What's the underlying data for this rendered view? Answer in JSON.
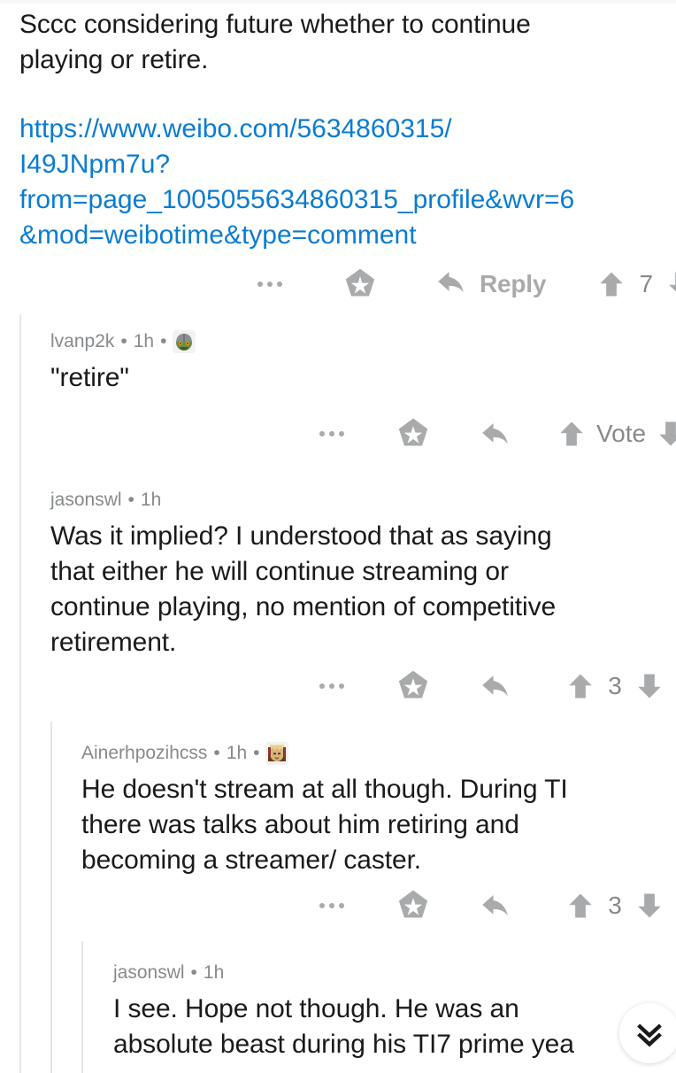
{
  "app": {
    "platform": "reddit-comment-thread",
    "link_color": "#0a7cd1",
    "meta_color": "#878a8c",
    "icon_color": "#a8aaab",
    "thread_line_color": "#e4e6e7",
    "background": "#ffffff"
  },
  "comments": [
    {
      "id": "root",
      "depth": 0,
      "body_lines": [
        "Sccc considering future whether to continue",
        "playing or retire."
      ],
      "link_lines": [
        "https://www.weibo.com/5634860315/",
        "I49JNpm7u?",
        "from=page_1005055634860315_profile&wvr=6",
        "&mod=weibotime&type=comment"
      ],
      "link_href": "https://www.weibo.com/5634860315/I49JNpm7u?from=page_1005055634860315_profile&wvr=6&mod=weibotime&type=comment",
      "actions": {
        "more_label": "more-options",
        "award_label": "award",
        "reply_label": "Reply",
        "upvote_label": "upvote",
        "score": "7",
        "downvote_label": "downvote"
      }
    },
    {
      "id": "c1",
      "depth": 1,
      "author": "lvanp2k",
      "timestamp": "1h",
      "has_flair": true,
      "flair_name": "green-creature-avatar",
      "body_lines": [
        "\"retire\""
      ],
      "actions": {
        "more_label": "more-options",
        "award_label": "award",
        "reply_label": "reply",
        "upvote_label": "upvote",
        "score": "Vote",
        "downvote_label": "downvote"
      }
    },
    {
      "id": "c2",
      "depth": 1,
      "author": "jasonswl",
      "timestamp": "1h",
      "has_flair": false,
      "body_lines": [
        "Was it implied? I understood that as saying",
        "that either he will continue streaming or",
        "continue playing, no mention of competitive",
        "retirement."
      ],
      "actions": {
        "more_label": "more-options",
        "award_label": "award",
        "reply_label": "reply",
        "upvote_label": "upvote",
        "score": "3",
        "downvote_label": "downvote"
      }
    },
    {
      "id": "c3",
      "depth": 2,
      "author": "Ainerhpozihcss",
      "timestamp": "1h",
      "has_flair": true,
      "flair_name": "blonde-hero-avatar",
      "body_lines": [
        "He doesn't stream at all though. During TI",
        "there was talks about him retiring and",
        "becoming a streamer/ caster."
      ],
      "actions": {
        "more_label": "more-options",
        "award_label": "award",
        "reply_label": "reply",
        "upvote_label": "upvote",
        "score": "3",
        "downvote_label": "downvote"
      }
    },
    {
      "id": "c4",
      "depth": 3,
      "author": "jasonswl",
      "timestamp": "1h",
      "has_flair": false,
      "body_lines": [
        "I see. Hope not though. He was an",
        "absolute beast during his TI7 prime yea"
      ]
    }
  ],
  "fab": {
    "name": "next-comment-button",
    "icon": "double-chevron-down"
  },
  "separators": {
    "bullet": "•"
  }
}
